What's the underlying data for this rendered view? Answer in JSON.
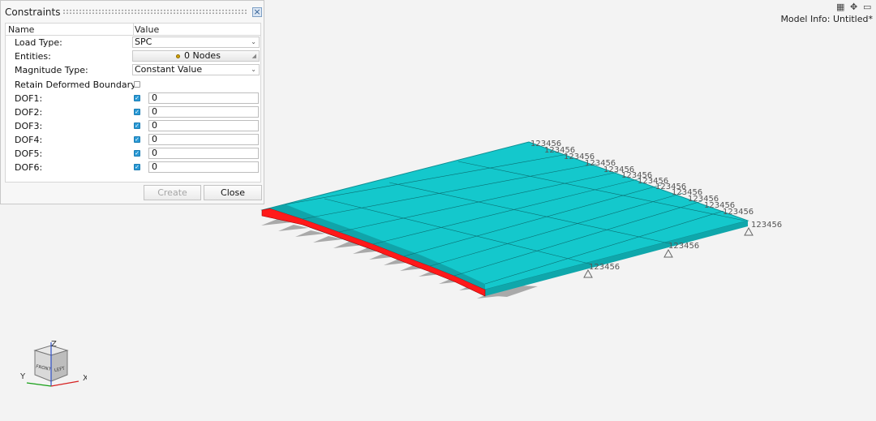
{
  "panel": {
    "title": "Constraints",
    "close_glyph": "×",
    "columns": {
      "name": "Name",
      "value": "Value"
    },
    "load_type": {
      "label": "Load Type:",
      "value": "SPC"
    },
    "entities": {
      "label": "Entities:",
      "value": "0 Nodes"
    },
    "magnitude_type": {
      "label": "Magnitude Type:",
      "value": "Constant Value"
    },
    "retain_deformed": {
      "label": "Retain Deformed Boundary:",
      "checked": false
    },
    "dofs": [
      {
        "label": "DOF1:",
        "checked": true,
        "value": "0"
      },
      {
        "label": "DOF2:",
        "checked": true,
        "value": "0"
      },
      {
        "label": "DOF3:",
        "checked": true,
        "value": "0"
      },
      {
        "label": "DOF4:",
        "checked": true,
        "value": "0"
      },
      {
        "label": "DOF5:",
        "checked": true,
        "value": "0"
      },
      {
        "label": "DOF6:",
        "checked": true,
        "value": "0"
      }
    ],
    "create_label": "Create",
    "close_label": "Close"
  },
  "model_info": "Model Info: Untitled*",
  "top_right_icons": [
    "grid-icon",
    "move-icon",
    "window-icon"
  ],
  "dof_label": "123456",
  "view_cube": {
    "front": "FRONT",
    "left": "LEFT",
    "axes": {
      "x": "X",
      "y": "Y",
      "z": "Z"
    }
  },
  "colors": {
    "surface": "#14c8cc",
    "surface_edge": "#0e8f93",
    "constraint_face": "#ff1a1a",
    "shadow": "#9a9a9a",
    "background": "#f3f3f3"
  }
}
